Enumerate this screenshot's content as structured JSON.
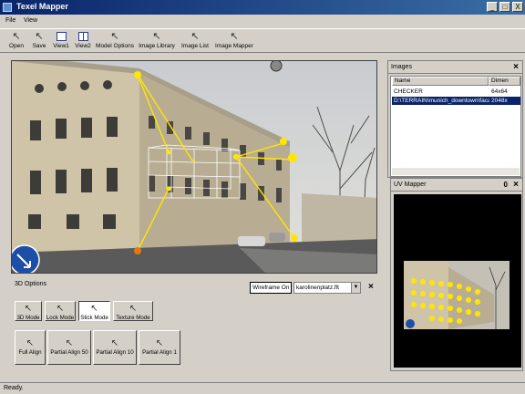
{
  "window": {
    "title": "Texel Mapper",
    "controls": [
      "_",
      "□",
      "X"
    ]
  },
  "menu": [
    "File",
    "View"
  ],
  "toolbar": [
    {
      "label": "Open",
      "icon": "arrow-icon"
    },
    {
      "label": "Save",
      "icon": "arrow-icon"
    },
    {
      "label": "View1",
      "icon": "view-icon"
    },
    {
      "label": "View2",
      "icon": "view-icon"
    },
    {
      "label": "Model Options",
      "icon": "arrow-icon"
    },
    {
      "label": "Image Library",
      "icon": "arrow-icon"
    },
    {
      "label": "Image List",
      "icon": "arrow-icon"
    },
    {
      "label": "Image Mapper",
      "icon": "arrow-icon"
    }
  ],
  "images_panel": {
    "title": "Images",
    "close": "×",
    "columns": [
      "Name",
      "Dimen"
    ],
    "rows": [
      {
        "name": "CHECKER",
        "dim": "64x64",
        "selected": false
      },
      {
        "name": "D:\\TERRAIN\\munich_downtown\\faca...",
        "dim": "2048x",
        "selected": true
      }
    ]
  },
  "uv_panel": {
    "title": "UV Mapper",
    "pin": "0",
    "close": "×"
  },
  "options": {
    "title": "3D Options",
    "wireframe_label": "Wireframe On",
    "file_value": "karolinenplatz.flt",
    "close": "×",
    "mode_buttons": [
      {
        "label": "3D Mode",
        "active": false
      },
      {
        "label": "Lock Mode",
        "active": false
      },
      {
        "label": "Stick Mode",
        "active": true
      },
      {
        "label": "Texture Mode",
        "active": false
      }
    ],
    "align_buttons": [
      "Full Align",
      "Partial Align 50",
      "Partial Align 10",
      "Partial Align 1"
    ]
  },
  "status": "Ready.",
  "colors": {
    "accent": "#0a246a",
    "control_point": "#ffe600",
    "control_point_alt": "#e07a10"
  }
}
